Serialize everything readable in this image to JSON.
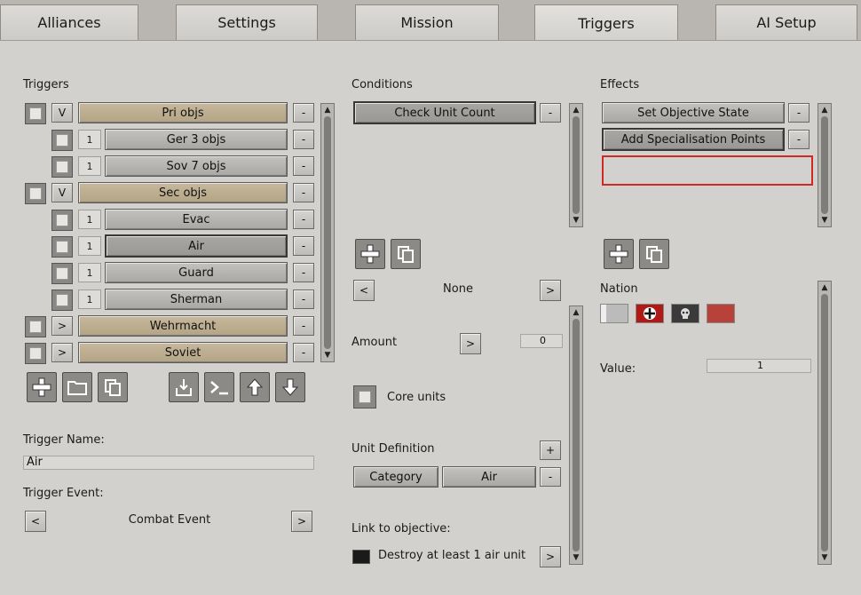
{
  "tabs": [
    "Alliances",
    "Settings",
    "Mission",
    "Triggers",
    "AI Setup"
  ],
  "triggers": {
    "heading": "Triggers",
    "rows": [
      {
        "expander": "V",
        "label": "Pri objs",
        "remove": "-"
      },
      {
        "count": "1",
        "label": "Ger 3 objs",
        "remove": "-"
      },
      {
        "count": "1",
        "label": "Sov 7 objs",
        "remove": "-"
      },
      {
        "expander": "V",
        "label": "Sec objs",
        "remove": "-"
      },
      {
        "count": "1",
        "label": "Evac",
        "remove": "-"
      },
      {
        "count": "1",
        "label": "Air",
        "remove": "-"
      },
      {
        "count": "1",
        "label": "Guard",
        "remove": "-"
      },
      {
        "count": "1",
        "label": "Sherman",
        "remove": "-"
      },
      {
        "expander": ">",
        "label": "Wehrmacht",
        "remove": "-"
      },
      {
        "expander": ">",
        "label": "Soviet",
        "remove": "-"
      }
    ],
    "name_label": "Trigger Name:",
    "name_value": "Air",
    "event_label": "Trigger Event:",
    "event_value": "Combat Event",
    "event_prev": "<",
    "event_next": ">"
  },
  "conditions": {
    "heading": "Conditions",
    "items": [
      {
        "label": "Check Unit Count",
        "remove": "-"
      }
    ],
    "selector_prev": "<",
    "selector_value": "None",
    "selector_next": ">",
    "amount_label": "Amount",
    "amount_button": ">",
    "amount_value": "0",
    "core_units_label": "Core units",
    "unit_def_label": "Unit Definition",
    "unit_def_add": "+",
    "unit_def_remove": "-",
    "category_button": "Category",
    "category_value": "Air",
    "link_label": "Link to objective:",
    "link_value": "Destroy at least 1 air unit",
    "link_next": ">"
  },
  "effects": {
    "heading": "Effects",
    "items": [
      {
        "label": "Set Objective State",
        "remove": "-"
      },
      {
        "label": "Add Specialisation Points",
        "remove": "-"
      }
    ],
    "nation_label": "Nation",
    "value_label": "Value:",
    "value_value": "1"
  },
  "icons": {
    "add": "plus-icon",
    "copy": "copy-icon",
    "folder": "folder-icon",
    "import": "import-icon",
    "console": "console-icon",
    "up": "arrow-up-icon",
    "down": "arrow-down-icon"
  },
  "colors": {
    "tan_button": "#c8b89c",
    "highlight_box": "#cc2a22"
  }
}
